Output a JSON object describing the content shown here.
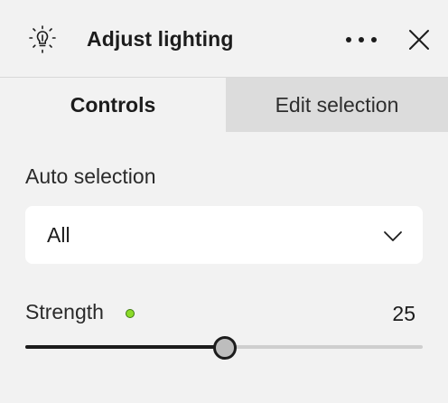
{
  "header": {
    "title": "Adjust lighting",
    "icon": "lighting-bulb-icon",
    "more_icon": "more-horizontal-icon",
    "close_icon": "close-icon"
  },
  "tabs": [
    {
      "label": "Controls",
      "active": true
    },
    {
      "label": "Edit selection",
      "active": false
    }
  ],
  "auto_selection": {
    "label": "Auto selection",
    "value": "All",
    "chevron_icon": "chevron-down-icon"
  },
  "strength": {
    "label": "Strength",
    "value": "25",
    "fraction": 0.5,
    "dot_color": "#8cdb29"
  }
}
